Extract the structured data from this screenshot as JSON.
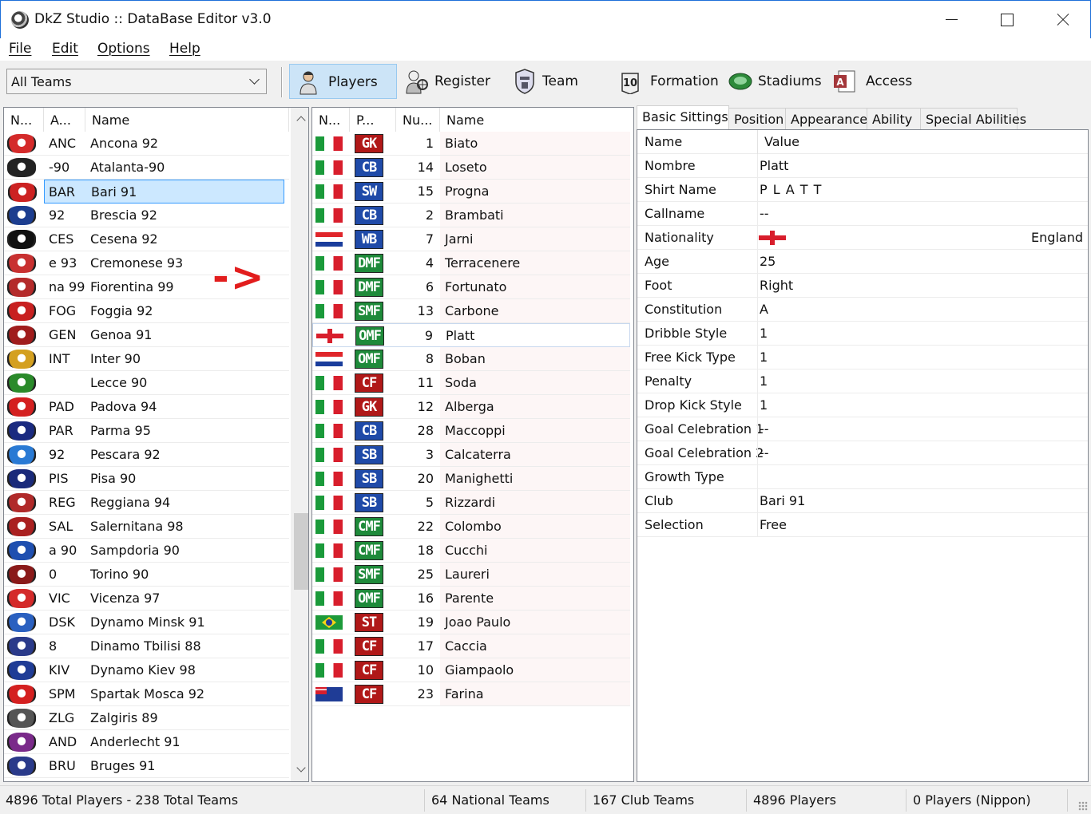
{
  "window": {
    "title": "DkZ Studio :: DataBase Editor v3.0"
  },
  "menu": [
    "File",
    "Edit",
    "Options",
    "Help"
  ],
  "toolbar": {
    "team_filter": "All Teams",
    "buttons": [
      {
        "label": "Players",
        "icon": "player-icon",
        "active": true
      },
      {
        "label": "Register",
        "icon": "register-icon"
      },
      {
        "label": "Team",
        "icon": "team-icon"
      },
      {
        "label": "Formation",
        "icon": "formation-icon"
      },
      {
        "label": "Stadiums",
        "icon": "stadium-icon"
      },
      {
        "label": "Access",
        "icon": "access-icon"
      }
    ]
  },
  "teams": {
    "headers": [
      "N...",
      "A...",
      "Name"
    ],
    "selected": "Bari 91",
    "rows": [
      {
        "abbr": "ANC",
        "name": "Ancona 92",
        "color": "#d42a2a"
      },
      {
        "abbr": "-90",
        "name": "Atalanta-90",
        "color": "#222222"
      },
      {
        "abbr": "BAR",
        "name": "Bari 91",
        "color": "#cc2222"
      },
      {
        "abbr": "92",
        "name": "Brescia 92",
        "color": "#1c3d8f"
      },
      {
        "abbr": "CES",
        "name": "Cesena 92",
        "color": "#111111"
      },
      {
        "abbr": "e 93",
        "name": "Cremonese 93",
        "color": "#c83030"
      },
      {
        "abbr": "na 99",
        "name": "Fiorentina 99",
        "color": "#b42a2a"
      },
      {
        "abbr": "FOG",
        "name": "Foggia 92",
        "color": "#c82020"
      },
      {
        "abbr": "GEN",
        "name": "Genoa 91",
        "color": "#a01c1c"
      },
      {
        "abbr": "INT",
        "name": "Inter 90",
        "color": "#d4a020"
      },
      {
        "abbr": "",
        "name": "Lecce 90",
        "color": "#2a8a2a"
      },
      {
        "abbr": "PAD",
        "name": "Padova 94",
        "color": "#d42020"
      },
      {
        "abbr": "PAR",
        "name": "Parma 95",
        "color": "#1a2a80"
      },
      {
        "abbr": "92",
        "name": "Pescara 92",
        "color": "#2a7ad4"
      },
      {
        "abbr": "PIS",
        "name": "Pisa 90",
        "color": "#1a2a7a"
      },
      {
        "abbr": "REG",
        "name": "Reggiana 94",
        "color": "#b02a2a"
      },
      {
        "abbr": "SAL",
        "name": "Salernitana 98",
        "color": "#aa2020"
      },
      {
        "abbr": "a 90",
        "name": "Sampdoria 90",
        "color": "#1f4fb0"
      },
      {
        "abbr": "0",
        "name": "Torino 90",
        "color": "#8a1a1a"
      },
      {
        "abbr": "VIC",
        "name": "Vicenza 97",
        "color": "#d42a2a"
      },
      {
        "abbr": "DSK",
        "name": "Dynamo Minsk 91",
        "color": "#2a60c0"
      },
      {
        "abbr": "8",
        "name": "Dinamo Tbilisi 88",
        "color": "#2a3a8a"
      },
      {
        "abbr": "KIV",
        "name": "Dynamo Kiev 98",
        "color": "#1f3c96"
      },
      {
        "abbr": "SPM",
        "name": "Spartak Mosca 92",
        "color": "#d42020"
      },
      {
        "abbr": "ZLG",
        "name": "Zalgiris 89",
        "color": "#555555"
      },
      {
        "abbr": "AND",
        "name": "Anderlecht 91",
        "color": "#7a2a8a"
      },
      {
        "abbr": "BRU",
        "name": "Bruges 91",
        "color": "#2a3a8a"
      }
    ]
  },
  "arrow_text": "->",
  "players": {
    "headers": [
      "N...",
      "P...",
      "Nu...",
      "Name"
    ],
    "selected": "Platt",
    "rows": [
      {
        "flag": "it",
        "pos": "GK",
        "pos_color": "#b01818",
        "num": "1",
        "name": "Biato"
      },
      {
        "flag": "it",
        "pos": "CB",
        "pos_color": "#1f4aa8",
        "num": "14",
        "name": "Loseto"
      },
      {
        "flag": "it",
        "pos": "SW",
        "pos_color": "#1f4aa8",
        "num": "15",
        "name": "Progna"
      },
      {
        "flag": "it",
        "pos": "CB",
        "pos_color": "#1f4aa8",
        "num": "2",
        "name": "Brambati"
      },
      {
        "flag": "hr",
        "pos": "WB",
        "pos_color": "#1f4aa8",
        "num": "7",
        "name": "Jarni"
      },
      {
        "flag": "it",
        "pos": "DMF",
        "pos_color": "#1e8a3a",
        "num": "4",
        "name": "Terracenere"
      },
      {
        "flag": "it",
        "pos": "DMF",
        "pos_color": "#1e8a3a",
        "num": "6",
        "name": "Fortunato"
      },
      {
        "flag": "it",
        "pos": "SMF",
        "pos_color": "#1e8a3a",
        "num": "13",
        "name": "Carbone"
      },
      {
        "flag": "en",
        "pos": "OMF",
        "pos_color": "#1e8a3a",
        "num": "9",
        "name": "Platt"
      },
      {
        "flag": "hr",
        "pos": "OMF",
        "pos_color": "#1e8a3a",
        "num": "8",
        "name": "Boban"
      },
      {
        "flag": "it",
        "pos": "CF",
        "pos_color": "#b01818",
        "num": "11",
        "name": "Soda"
      },
      {
        "flag": "it",
        "pos": "GK",
        "pos_color": "#b01818",
        "num": "12",
        "name": "Alberga"
      },
      {
        "flag": "it",
        "pos": "CB",
        "pos_color": "#1f4aa8",
        "num": "28",
        "name": "Maccoppi"
      },
      {
        "flag": "it",
        "pos": "SB",
        "pos_color": "#1f4aa8",
        "num": "3",
        "name": "Calcaterra"
      },
      {
        "flag": "it",
        "pos": "SB",
        "pos_color": "#1f4aa8",
        "num": "20",
        "name": "Manighetti"
      },
      {
        "flag": "it",
        "pos": "SB",
        "pos_color": "#1f4aa8",
        "num": "5",
        "name": "Rizzardi"
      },
      {
        "flag": "it",
        "pos": "CMF",
        "pos_color": "#1e8a3a",
        "num": "22",
        "name": "Colombo"
      },
      {
        "flag": "it",
        "pos": "CMF",
        "pos_color": "#1e8a3a",
        "num": "18",
        "name": "Cucchi"
      },
      {
        "flag": "it",
        "pos": "SMF",
        "pos_color": "#1e8a3a",
        "num": "25",
        "name": "Laureri"
      },
      {
        "flag": "it",
        "pos": "OMF",
        "pos_color": "#1e8a3a",
        "num": "16",
        "name": "Parente"
      },
      {
        "flag": "br",
        "pos": "ST",
        "pos_color": "#b01818",
        "num": "19",
        "name": "Joao Paulo"
      },
      {
        "flag": "it",
        "pos": "CF",
        "pos_color": "#b01818",
        "num": "17",
        "name": "Caccia"
      },
      {
        "flag": "it",
        "pos": "CF",
        "pos_color": "#b01818",
        "num": "10",
        "name": "Giampaolo"
      },
      {
        "flag": "au",
        "pos": "CF",
        "pos_color": "#b01818",
        "num": "23",
        "name": "Farina"
      }
    ]
  },
  "details": {
    "tabs": [
      "Basic Sittings",
      "Position",
      "Appearance",
      "Ability",
      "Special Abilities"
    ],
    "active_tab": "Basic Sittings",
    "header": {
      "name": "Name",
      "value": "Value"
    },
    "rows": [
      {
        "name": "Nombre",
        "value": "Platt"
      },
      {
        "name": "Shirt Name",
        "value": "P L A T T"
      },
      {
        "name": "Callname",
        "value": "--"
      },
      {
        "name": "Nationality",
        "value": "England",
        "flag": "en"
      },
      {
        "name": "Age",
        "value": "25"
      },
      {
        "name": "Foot",
        "value": "Right"
      },
      {
        "name": "Constitution",
        "value": "A"
      },
      {
        "name": "Dribble Style",
        "value": "1"
      },
      {
        "name": "Free Kick Type",
        "value": "1"
      },
      {
        "name": "Penalty",
        "value": "1"
      },
      {
        "name": "Drop Kick Style",
        "value": "1"
      },
      {
        "name": "Goal Celebration 1",
        "value": "--"
      },
      {
        "name": "Goal Celebration 2",
        "value": "--"
      },
      {
        "name": "Growth Type",
        "value": ""
      },
      {
        "name": "Club",
        "value": "Bari 91"
      },
      {
        "name": "Selection",
        "value": "Free"
      }
    ]
  },
  "status": {
    "totals": "4896 Total Players  -  238 Total Teams",
    "national": "64 National Teams",
    "club": "167 Club Teams",
    "players": "4896 Players",
    "nippon": "0 Players (Nippon)"
  }
}
